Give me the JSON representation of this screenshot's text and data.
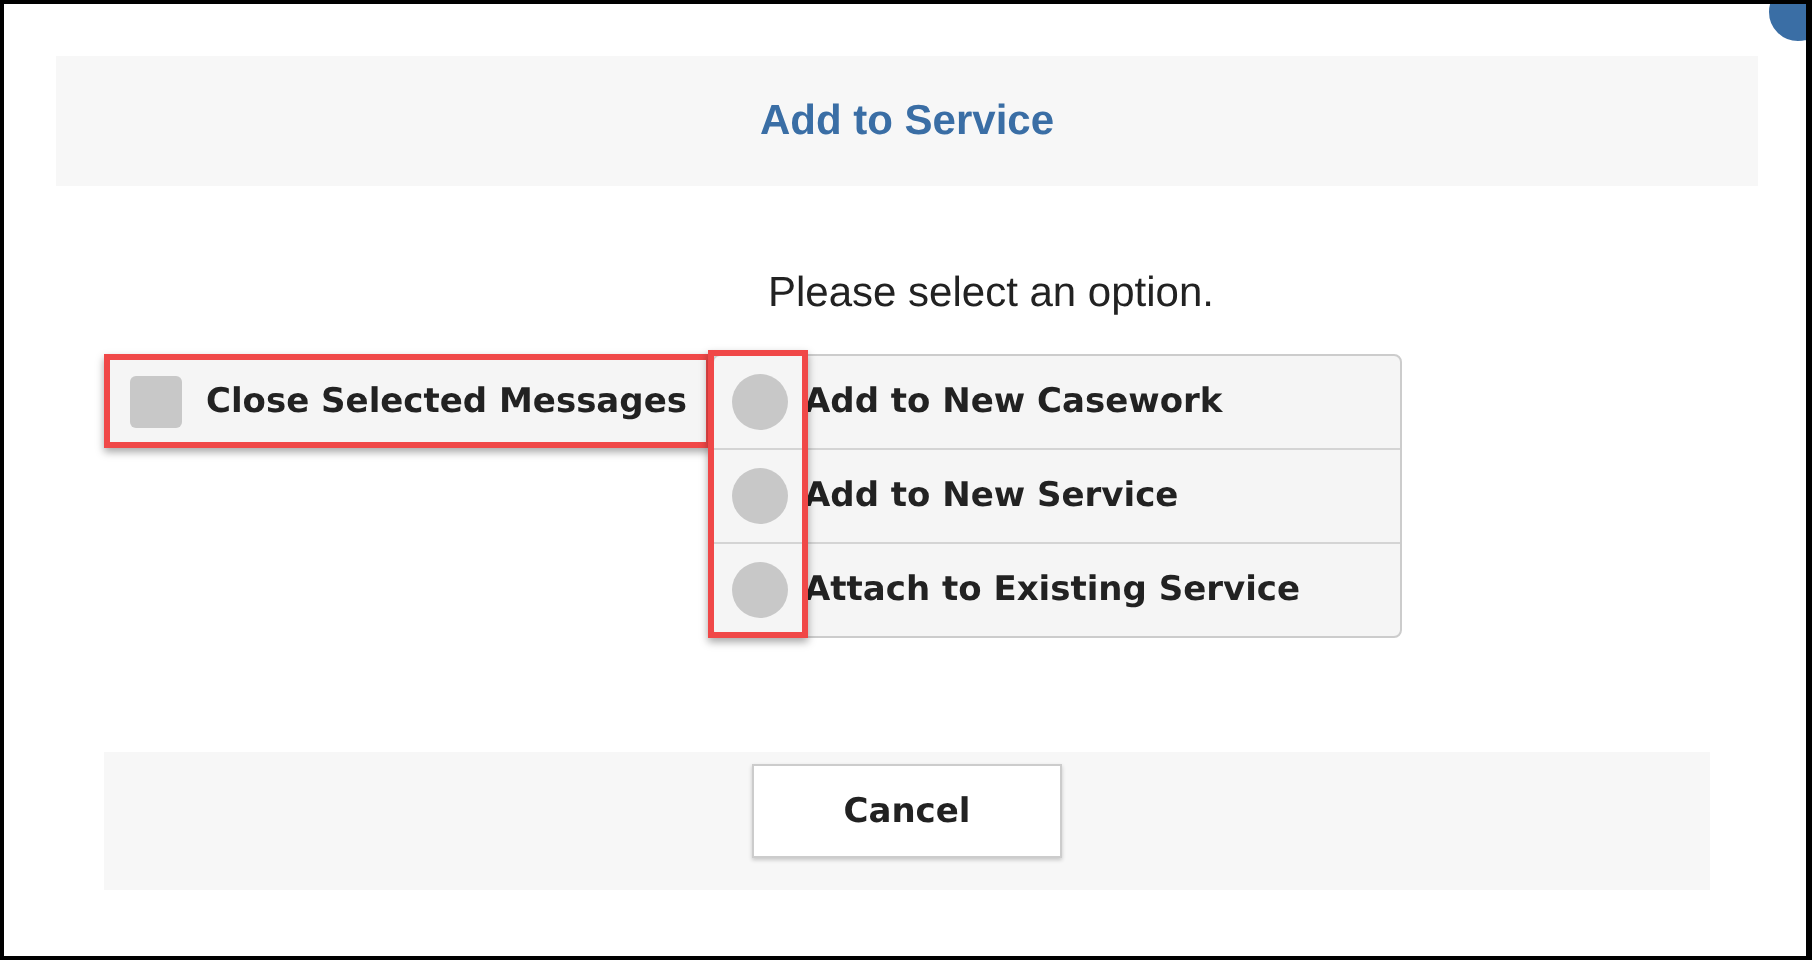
{
  "dialog": {
    "title": "Add to Service",
    "prompt": "Please select an option.",
    "close_messages": {
      "label": "Close Selected Messages",
      "checked": false,
      "highlighted": true
    },
    "options_highlighted": true,
    "options": [
      {
        "label": "Add to New Casework",
        "selected": false
      },
      {
        "label": "Add to New Service",
        "selected": false
      },
      {
        "label": "Attach to Existing Service",
        "selected": false
      }
    ],
    "buttons": [
      "Cancel"
    ]
  }
}
